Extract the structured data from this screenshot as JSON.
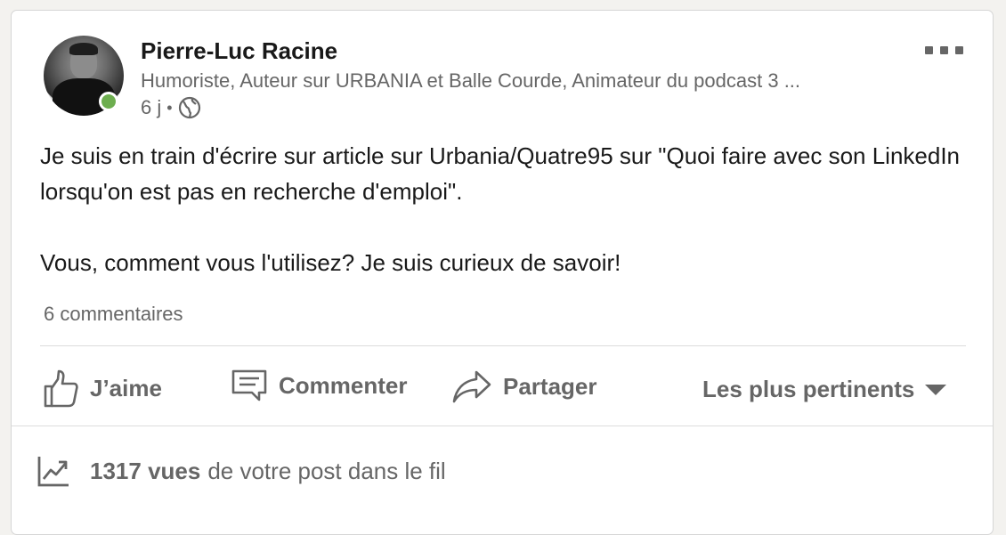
{
  "post": {
    "author_name": "Pierre-Luc Racine",
    "author_headline": "Humoriste, Auteur sur URBANIA et Balle Courde, Animateur du podcast 3 ...",
    "time_ago": "6 j",
    "meta_separator": "•",
    "visibility_icon": "globe-icon",
    "presence_status_color": "#6dae4f",
    "body_line1": "Je suis en train d'écrire sur article sur Urbania/Quatre95 sur \"Quoi faire avec son LinkedIn lorsqu'on est pas en recherche d'emploi\".",
    "body_line2": "Vous, comment vous l'utilisez? Je suis curieux de savoir!",
    "comments_count": "6 commentaires"
  },
  "actions": {
    "like": "J’aime",
    "comment": "Commenter",
    "share": "Partager",
    "sort": "Les plus pertinents"
  },
  "stats": {
    "views_count": "1317 vues",
    "views_suffix": "de votre post dans le fil"
  }
}
